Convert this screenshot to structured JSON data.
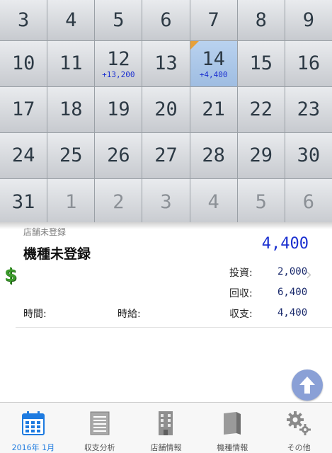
{
  "calendar": {
    "weeks": [
      [
        {
          "day": "3"
        },
        {
          "day": "4"
        },
        {
          "day": "5"
        },
        {
          "day": "6"
        },
        {
          "day": "7"
        },
        {
          "day": "8"
        },
        {
          "day": "9"
        }
      ],
      [
        {
          "day": "10"
        },
        {
          "day": "11"
        },
        {
          "day": "12",
          "amount": "+13,200"
        },
        {
          "day": "13"
        },
        {
          "day": "14",
          "amount": "+4,400",
          "selected": true,
          "marker": true
        },
        {
          "day": "15"
        },
        {
          "day": "16"
        }
      ],
      [
        {
          "day": "17"
        },
        {
          "day": "18"
        },
        {
          "day": "19"
        },
        {
          "day": "20"
        },
        {
          "day": "21"
        },
        {
          "day": "22"
        },
        {
          "day": "23"
        }
      ],
      [
        {
          "day": "24"
        },
        {
          "day": "25"
        },
        {
          "day": "26"
        },
        {
          "day": "27"
        },
        {
          "day": "28"
        },
        {
          "day": "29"
        },
        {
          "day": "30"
        }
      ],
      [
        {
          "day": "31"
        },
        {
          "day": "1",
          "other": true
        },
        {
          "day": "2",
          "other": true
        },
        {
          "day": "3",
          "other": true
        },
        {
          "day": "4",
          "other": true
        },
        {
          "day": "5",
          "other": true
        },
        {
          "day": "6",
          "other": true
        }
      ]
    ],
    "colors": {
      "amount": "#1a2fd0",
      "selected_bg": "#a9c7ea",
      "marker": "#e6a03a"
    }
  },
  "detail": {
    "store": "店舗未登録",
    "machine": "機種未登録",
    "total": "4,400",
    "investment_label": "投資:",
    "investment_value": "2,000",
    "recovery_label": "回収:",
    "recovery_value": "6,400",
    "balance_label": "収支:",
    "balance_value": "4,400",
    "time_label": "時間:",
    "hourly_label": "時給:",
    "icon": "dollar-icon"
  },
  "tabs": [
    {
      "label": "2016年 1月",
      "icon": "calendar-icon",
      "active": true
    },
    {
      "label": "収支分析",
      "icon": "document-icon"
    },
    {
      "label": "店舗情報",
      "icon": "building-icon"
    },
    {
      "label": "機種情報",
      "icon": "book-icon"
    },
    {
      "label": "その他",
      "icon": "gear-icon"
    }
  ]
}
